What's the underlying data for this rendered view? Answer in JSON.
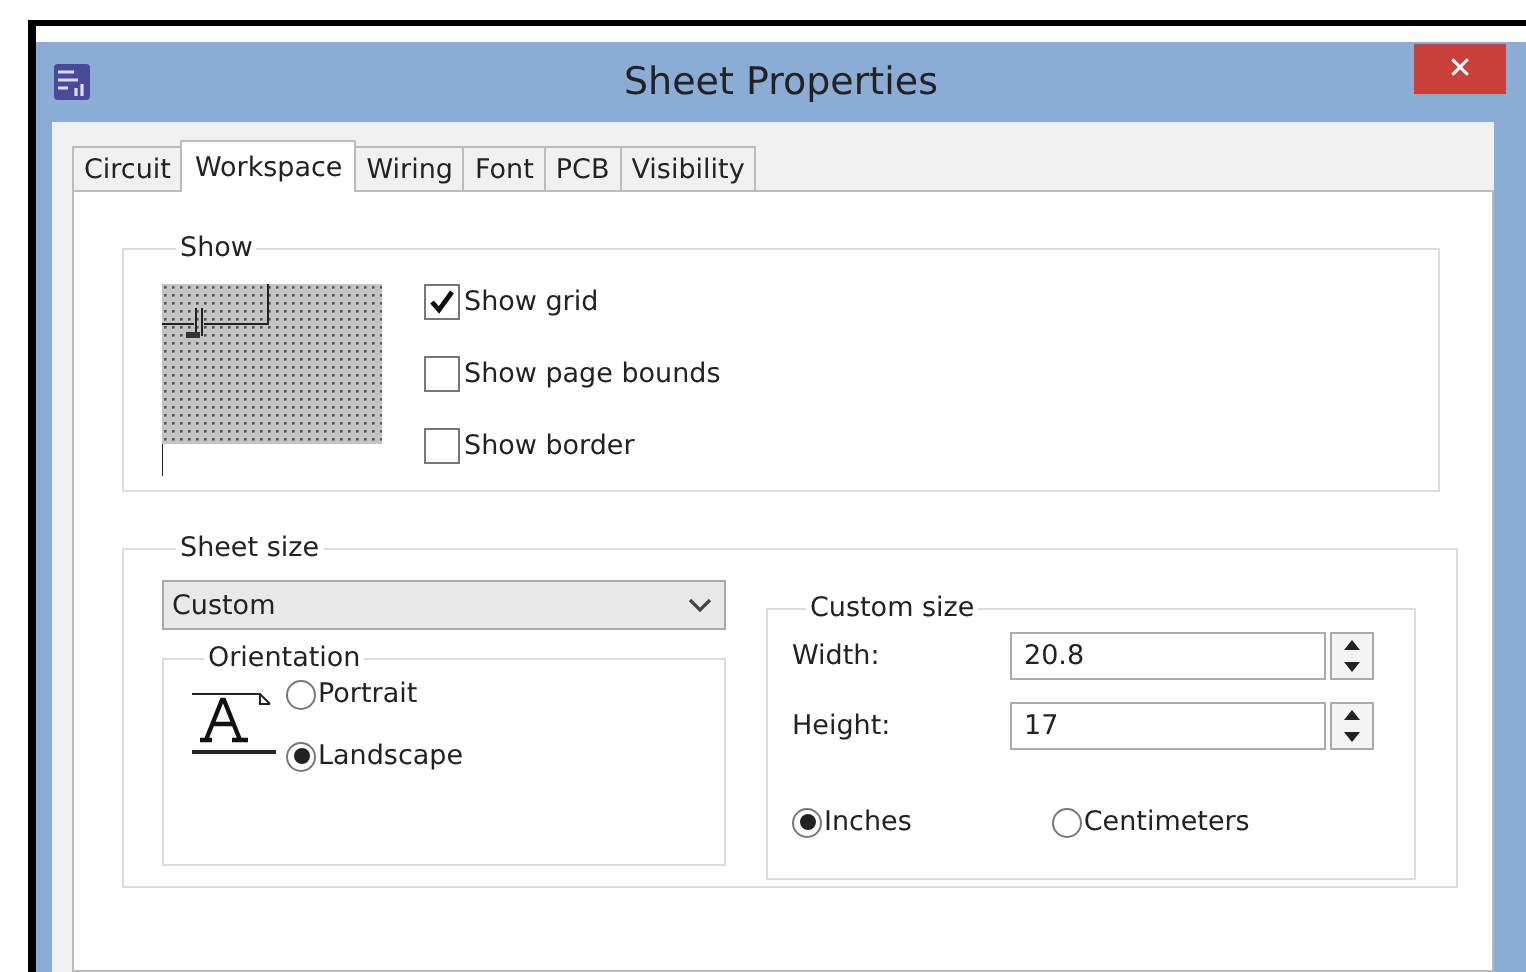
{
  "window": {
    "title": "Sheet Properties",
    "close": "✕"
  },
  "tabs": [
    {
      "label": "Circuit",
      "selected": false
    },
    {
      "label": "Workspace",
      "selected": true
    },
    {
      "label": "Wiring",
      "selected": false
    },
    {
      "label": "Font",
      "selected": false
    },
    {
      "label": "PCB",
      "selected": false
    },
    {
      "label": "Visibility",
      "selected": false
    }
  ],
  "show": {
    "title": "Show",
    "options": [
      {
        "label": "Show grid",
        "checked": true
      },
      {
        "label": "Show page bounds",
        "checked": false
      },
      {
        "label": "Show border",
        "checked": false
      }
    ]
  },
  "sheet_size": {
    "title": "Sheet size",
    "dropdown": {
      "value": "Custom"
    },
    "orientation": {
      "title": "Orientation",
      "options": [
        {
          "label": "Portrait",
          "selected": false
        },
        {
          "label": "Landscape",
          "selected": true
        }
      ]
    },
    "custom_size": {
      "title": "Custom size",
      "fields": [
        {
          "label": "Width:",
          "value": "20.8"
        },
        {
          "label": "Height:",
          "value": "17"
        }
      ],
      "units": [
        {
          "label": "Inches",
          "selected": true
        },
        {
          "label": "Centimeters",
          "selected": false
        }
      ]
    }
  }
}
